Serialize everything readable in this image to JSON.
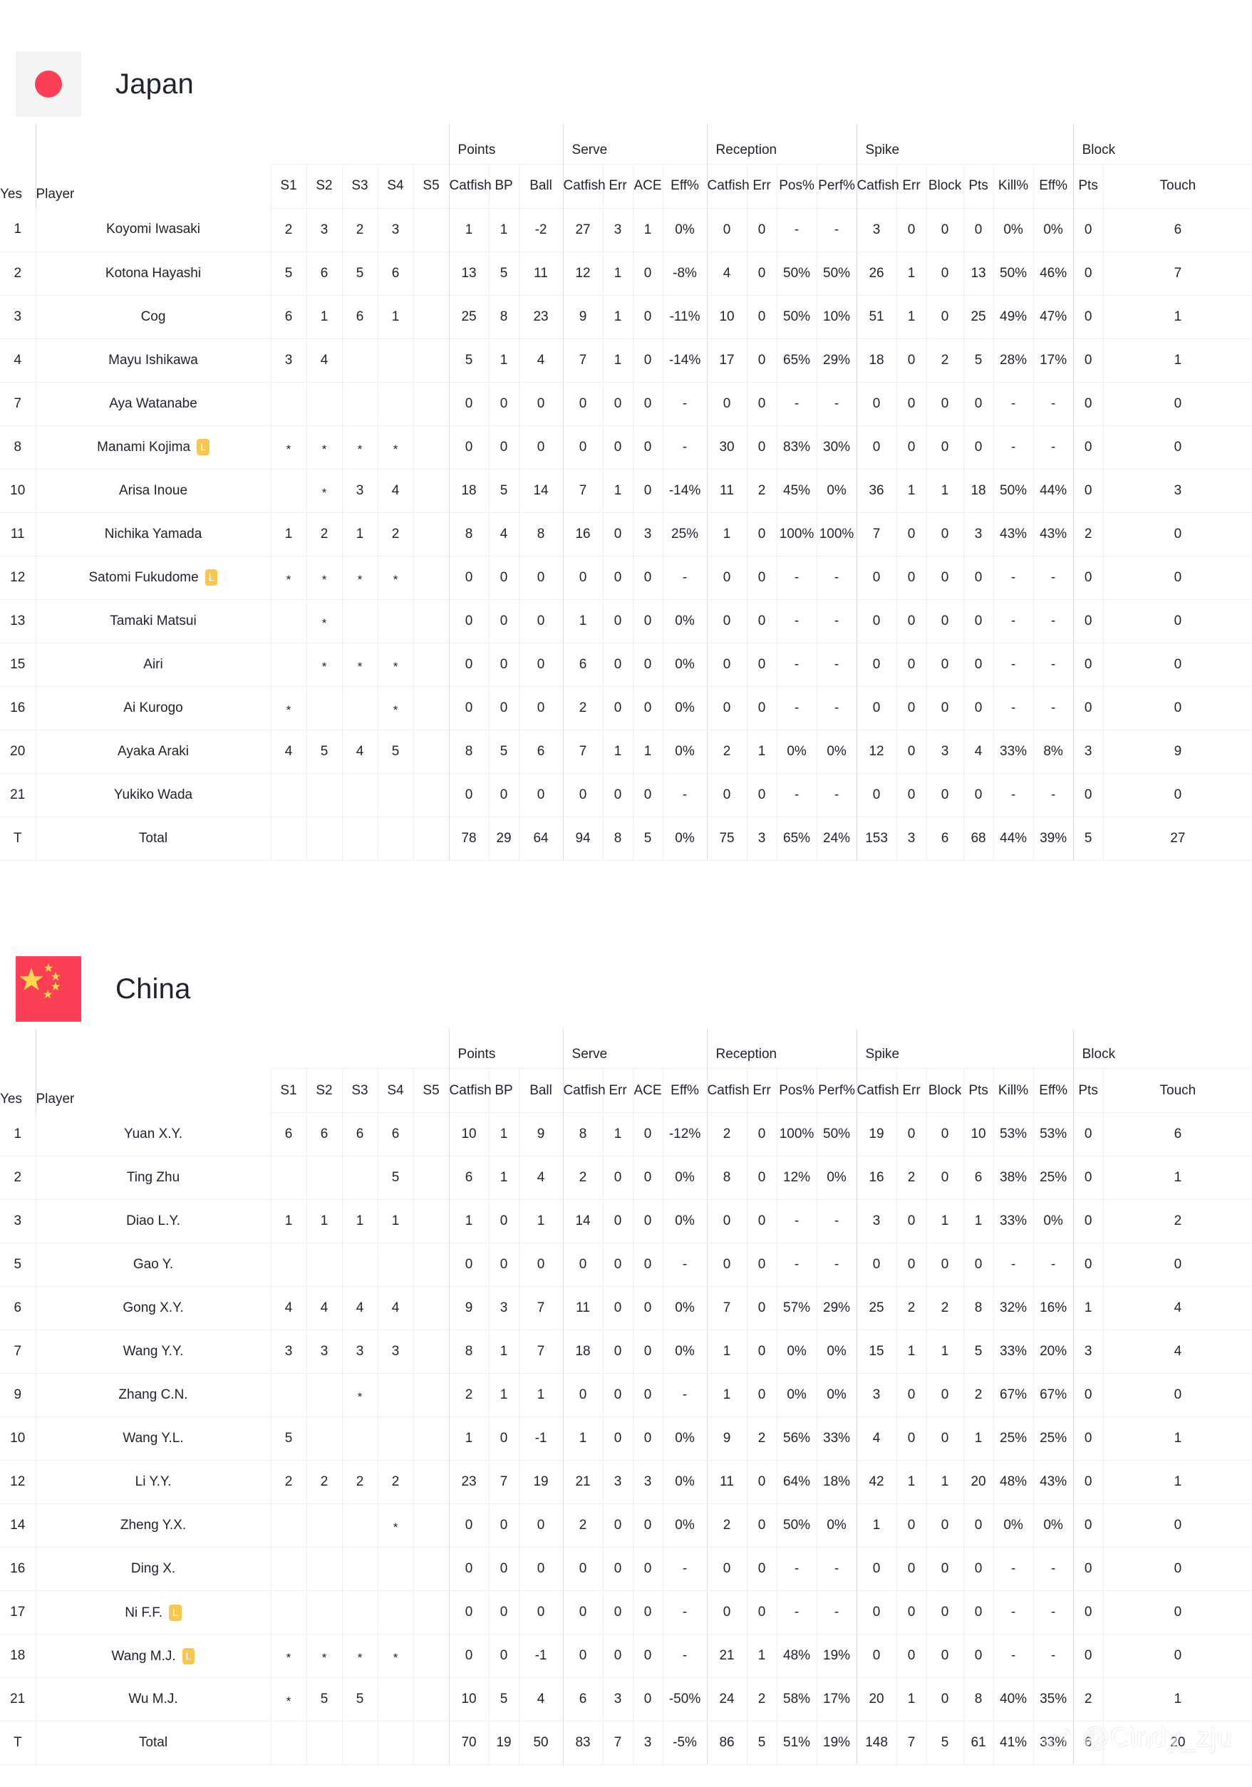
{
  "watermark": {
    "handle": "@Cindy_zju",
    "logo": "weibo-icon"
  },
  "column_groups": [
    {
      "label": "",
      "span": 5
    },
    {
      "label": "Points",
      "span": 3
    },
    {
      "label": "Serve",
      "span": 4
    },
    {
      "label": "Reception",
      "span": 4
    },
    {
      "label": "Spike",
      "span": 6
    },
    {
      "label": "Block",
      "span": 2
    }
  ],
  "columns": {
    "yes": "Yes",
    "player": "Player",
    "sets": [
      "S1",
      "S2",
      "S3",
      "S4",
      "S5"
    ],
    "points": [
      "Catfish",
      "BP",
      "Ball"
    ],
    "serve": [
      "Catfish",
      "Err",
      "ACE",
      "Eff%"
    ],
    "reception": [
      "Catfish",
      "Err",
      "Pos%",
      "Perf%"
    ],
    "spike": [
      "Catfish",
      "Err",
      "Block",
      "Pts",
      "Kill%",
      "Eff%"
    ],
    "block": [
      "Pts",
      "Touch"
    ]
  },
  "teams": [
    {
      "name": "Japan",
      "flag": "flag-japan",
      "rows": [
        {
          "no": "1",
          "player": "Koyomi Iwasaki",
          "libero": false,
          "cells": [
            "2",
            "3",
            "2",
            "3",
            "",
            "1",
            "1",
            "-2",
            "27",
            "3",
            "1",
            "0%",
            "0",
            "0",
            "-",
            "-",
            "3",
            "0",
            "0",
            "0",
            "0%",
            "0%",
            "0",
            "6"
          ]
        },
        {
          "no": "2",
          "player": "Kotona Hayashi",
          "libero": false,
          "cells": [
            "5",
            "6",
            "5",
            "6",
            "",
            "13",
            "5",
            "11",
            "12",
            "1",
            "0",
            "-8%",
            "4",
            "0",
            "50%",
            "50%",
            "26",
            "1",
            "0",
            "13",
            "50%",
            "46%",
            "0",
            "7"
          ]
        },
        {
          "no": "3",
          "player": "Cog",
          "libero": false,
          "cells": [
            "6",
            "1",
            "6",
            "1",
            "",
            "25",
            "8",
            "23",
            "9",
            "1",
            "0",
            "-11%",
            "10",
            "0",
            "50%",
            "10%",
            "51",
            "1",
            "0",
            "25",
            "49%",
            "47%",
            "0",
            "1"
          ]
        },
        {
          "no": "4",
          "player": "Mayu Ishikawa",
          "libero": false,
          "cells": [
            "3",
            "4",
            "",
            "",
            "",
            "5",
            "1",
            "4",
            "7",
            "1",
            "0",
            "-14%",
            "17",
            "0",
            "65%",
            "29%",
            "18",
            "0",
            "2",
            "5",
            "28%",
            "17%",
            "0",
            "1"
          ]
        },
        {
          "no": "7",
          "player": "Aya Watanabe",
          "libero": false,
          "cells": [
            "",
            "",
            "",
            "",
            "",
            "0",
            "0",
            "0",
            "0",
            "0",
            "0",
            "-",
            "0",
            "0",
            "-",
            "-",
            "0",
            "0",
            "0",
            "0",
            "-",
            "-",
            "0",
            "0"
          ]
        },
        {
          "no": "8",
          "player": "Manami Kojima",
          "libero": true,
          "cells": [
            "*",
            "*",
            "*",
            "*",
            "",
            "0",
            "0",
            "0",
            "0",
            "0",
            "0",
            "-",
            "30",
            "0",
            "83%",
            "30%",
            "0",
            "0",
            "0",
            "0",
            "-",
            "-",
            "0",
            "0"
          ]
        },
        {
          "no": "10",
          "player": "Arisa Inoue",
          "libero": false,
          "cells": [
            "",
            "*",
            "3",
            "4",
            "",
            "18",
            "5",
            "14",
            "7",
            "1",
            "0",
            "-14%",
            "11",
            "2",
            "45%",
            "0%",
            "36",
            "1",
            "1",
            "18",
            "50%",
            "44%",
            "0",
            "3"
          ]
        },
        {
          "no": "11",
          "player": "Nichika Yamada",
          "libero": false,
          "cells": [
            "1",
            "2",
            "1",
            "2",
            "",
            "8",
            "4",
            "8",
            "16",
            "0",
            "3",
            "25%",
            "1",
            "0",
            "100%",
            "100%",
            "7",
            "0",
            "0",
            "3",
            "43%",
            "43%",
            "2",
            "0"
          ]
        },
        {
          "no": "12",
          "player": "Satomi Fukudome",
          "libero": true,
          "cells": [
            "*",
            "*",
            "*",
            "*",
            "",
            "0",
            "0",
            "0",
            "0",
            "0",
            "0",
            "-",
            "0",
            "0",
            "-",
            "-",
            "0",
            "0",
            "0",
            "0",
            "-",
            "-",
            "0",
            "0"
          ]
        },
        {
          "no": "13",
          "player": "Tamaki Matsui",
          "libero": false,
          "cells": [
            "",
            "*",
            "",
            "",
            "",
            "0",
            "0",
            "0",
            "1",
            "0",
            "0",
            "0%",
            "0",
            "0",
            "-",
            "-",
            "0",
            "0",
            "0",
            "0",
            "-",
            "-",
            "0",
            "0"
          ]
        },
        {
          "no": "15",
          "player": "Airi",
          "libero": false,
          "cells": [
            "",
            "*",
            "*",
            "*",
            "",
            "0",
            "0",
            "0",
            "6",
            "0",
            "0",
            "0%",
            "0",
            "0",
            "-",
            "-",
            "0",
            "0",
            "0",
            "0",
            "-",
            "-",
            "0",
            "0"
          ]
        },
        {
          "no": "16",
          "player": "Ai Kurogo",
          "libero": false,
          "cells": [
            "*",
            "",
            "",
            "*",
            "",
            "0",
            "0",
            "0",
            "2",
            "0",
            "0",
            "0%",
            "0",
            "0",
            "-",
            "-",
            "0",
            "0",
            "0",
            "0",
            "-",
            "-",
            "0",
            "0"
          ]
        },
        {
          "no": "20",
          "player": "Ayaka Araki",
          "libero": false,
          "cells": [
            "4",
            "5",
            "4",
            "5",
            "",
            "8",
            "5",
            "6",
            "7",
            "1",
            "1",
            "0%",
            "2",
            "1",
            "0%",
            "0%",
            "12",
            "0",
            "3",
            "4",
            "33%",
            "8%",
            "3",
            "9"
          ]
        },
        {
          "no": "21",
          "player": "Yukiko Wada",
          "libero": false,
          "cells": [
            "",
            "",
            "",
            "",
            "",
            "0",
            "0",
            "0",
            "0",
            "0",
            "0",
            "-",
            "0",
            "0",
            "-",
            "-",
            "0",
            "0",
            "0",
            "0",
            "-",
            "-",
            "0",
            "0"
          ]
        }
      ],
      "total": {
        "no": "T",
        "player": "Total",
        "cells": [
          "",
          "",
          "",
          "",
          "",
          "78",
          "29",
          "64",
          "94",
          "8",
          "5",
          "0%",
          "75",
          "3",
          "65%",
          "24%",
          "153",
          "3",
          "6",
          "68",
          "44%",
          "39%",
          "5",
          "27"
        ]
      }
    },
    {
      "name": "China",
      "flag": "flag-china",
      "rows": [
        {
          "no": "1",
          "player": "Yuan X.Y.",
          "libero": false,
          "cells": [
            "6",
            "6",
            "6",
            "6",
            "",
            "10",
            "1",
            "9",
            "8",
            "1",
            "0",
            "-12%",
            "2",
            "0",
            "100%",
            "50%",
            "19",
            "0",
            "0",
            "10",
            "53%",
            "53%",
            "0",
            "6"
          ]
        },
        {
          "no": "2",
          "player": "Ting Zhu",
          "libero": false,
          "cells": [
            "",
            "",
            "",
            "5",
            "",
            "6",
            "1",
            "4",
            "2",
            "0",
            "0",
            "0%",
            "8",
            "0",
            "12%",
            "0%",
            "16",
            "2",
            "0",
            "6",
            "38%",
            "25%",
            "0",
            "1"
          ]
        },
        {
          "no": "3",
          "player": "Diao L.Y.",
          "libero": false,
          "cells": [
            "1",
            "1",
            "1",
            "1",
            "",
            "1",
            "0",
            "1",
            "14",
            "0",
            "0",
            "0%",
            "0",
            "0",
            "-",
            "-",
            "3",
            "0",
            "1",
            "1",
            "33%",
            "0%",
            "0",
            "2"
          ]
        },
        {
          "no": "5",
          "player": "Gao Y.",
          "libero": false,
          "cells": [
            "",
            "",
            "",
            "",
            "",
            "0",
            "0",
            "0",
            "0",
            "0",
            "0",
            "-",
            "0",
            "0",
            "-",
            "-",
            "0",
            "0",
            "0",
            "0",
            "-",
            "-",
            "0",
            "0"
          ]
        },
        {
          "no": "6",
          "player": "Gong X.Y.",
          "libero": false,
          "cells": [
            "4",
            "4",
            "4",
            "4",
            "",
            "9",
            "3",
            "7",
            "11",
            "0",
            "0",
            "0%",
            "7",
            "0",
            "57%",
            "29%",
            "25",
            "2",
            "2",
            "8",
            "32%",
            "16%",
            "1",
            "4"
          ]
        },
        {
          "no": "7",
          "player": "Wang Y.Y.",
          "libero": false,
          "cells": [
            "3",
            "3",
            "3",
            "3",
            "",
            "8",
            "1",
            "7",
            "18",
            "0",
            "0",
            "0%",
            "1",
            "0",
            "0%",
            "0%",
            "15",
            "1",
            "1",
            "5",
            "33%",
            "20%",
            "3",
            "4"
          ]
        },
        {
          "no": "9",
          "player": "Zhang C.N.",
          "libero": false,
          "cells": [
            "",
            "",
            "*",
            "",
            "",
            "2",
            "1",
            "1",
            "0",
            "0",
            "0",
            "-",
            "1",
            "0",
            "0%",
            "0%",
            "3",
            "0",
            "0",
            "2",
            "67%",
            "67%",
            "0",
            "0"
          ]
        },
        {
          "no": "10",
          "player": "Wang Y.L.",
          "libero": false,
          "cells": [
            "5",
            "",
            "",
            "",
            "",
            "1",
            "0",
            "-1",
            "1",
            "0",
            "0",
            "0%",
            "9",
            "2",
            "56%",
            "33%",
            "4",
            "0",
            "0",
            "1",
            "25%",
            "25%",
            "0",
            "1"
          ]
        },
        {
          "no": "12",
          "player": "Li Y.Y.",
          "libero": false,
          "cells": [
            "2",
            "2",
            "2",
            "2",
            "",
            "23",
            "7",
            "19",
            "21",
            "3",
            "3",
            "0%",
            "11",
            "0",
            "64%",
            "18%",
            "42",
            "1",
            "1",
            "20",
            "48%",
            "43%",
            "0",
            "1"
          ]
        },
        {
          "no": "14",
          "player": "Zheng Y.X.",
          "libero": false,
          "cells": [
            "",
            "",
            "",
            "*",
            "",
            "0",
            "0",
            "0",
            "2",
            "0",
            "0",
            "0%",
            "2",
            "0",
            "50%",
            "0%",
            "1",
            "0",
            "0",
            "0",
            "0%",
            "0%",
            "0",
            "0"
          ]
        },
        {
          "no": "16",
          "player": "Ding X.",
          "libero": false,
          "cells": [
            "",
            "",
            "",
            "",
            "",
            "0",
            "0",
            "0",
            "0",
            "0",
            "0",
            "-",
            "0",
            "0",
            "-",
            "-",
            "0",
            "0",
            "0",
            "0",
            "-",
            "-",
            "0",
            "0"
          ]
        },
        {
          "no": "17",
          "player": "Ni F.F.",
          "libero": true,
          "cells": [
            "",
            "",
            "",
            "",
            "",
            "0",
            "0",
            "0",
            "0",
            "0",
            "0",
            "-",
            "0",
            "0",
            "-",
            "-",
            "0",
            "0",
            "0",
            "0",
            "-",
            "-",
            "0",
            "0"
          ]
        },
        {
          "no": "18",
          "player": "Wang M.J.",
          "libero": true,
          "cells": [
            "*",
            "*",
            "*",
            "*",
            "",
            "0",
            "0",
            "-1",
            "0",
            "0",
            "0",
            "-",
            "21",
            "1",
            "48%",
            "19%",
            "0",
            "0",
            "0",
            "0",
            "-",
            "-",
            "0",
            "0"
          ]
        },
        {
          "no": "21",
          "player": "Wu M.J.",
          "libero": false,
          "cells": [
            "*",
            "5",
            "5",
            "",
            "",
            "10",
            "5",
            "4",
            "6",
            "3",
            "0",
            "-50%",
            "24",
            "2",
            "58%",
            "17%",
            "20",
            "1",
            "0",
            "8",
            "40%",
            "35%",
            "2",
            "1"
          ]
        }
      ],
      "total": {
        "no": "T",
        "player": "Total",
        "cells": [
          "",
          "",
          "",
          "",
          "",
          "70",
          "19",
          "50",
          "83",
          "7",
          "3",
          "-5%",
          "86",
          "5",
          "51%",
          "19%",
          "148",
          "7",
          "5",
          "61",
          "41%",
          "33%",
          "6",
          "20"
        ]
      }
    }
  ]
}
